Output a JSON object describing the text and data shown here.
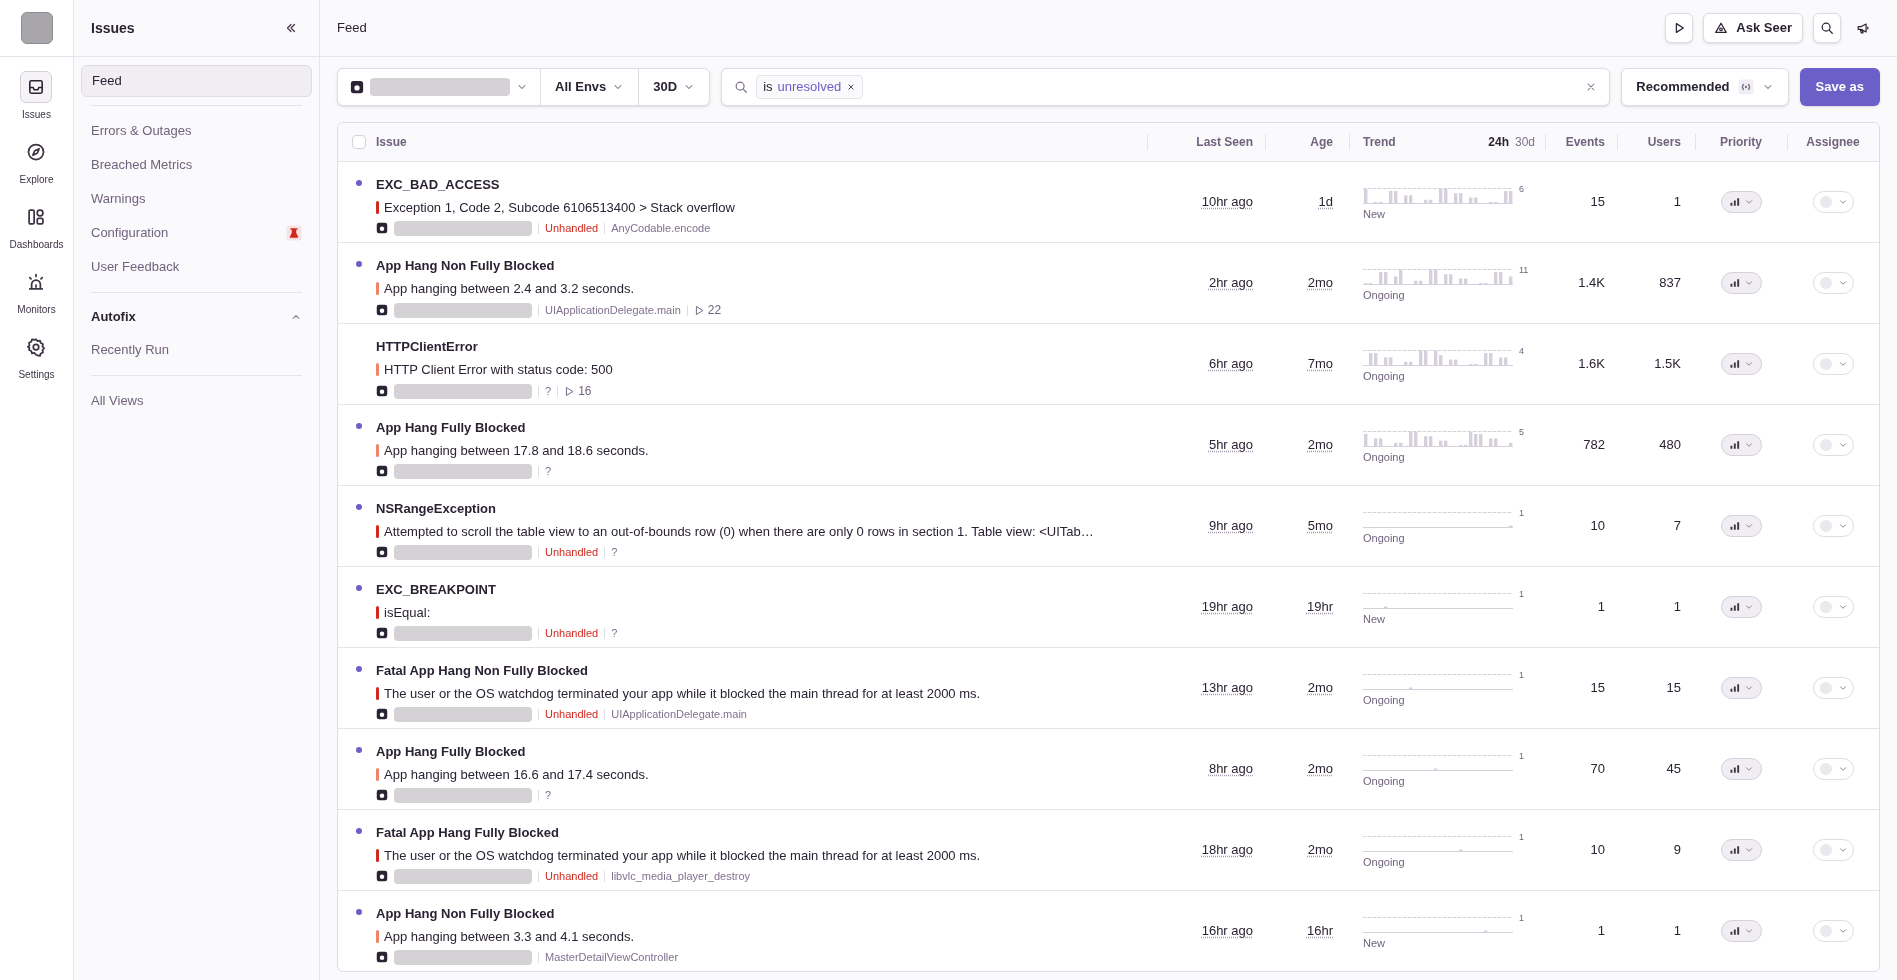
{
  "nav": {
    "items": [
      {
        "kind": "issues",
        "label": "Issues",
        "selected": true
      },
      {
        "kind": "explore",
        "label": "Explore",
        "selected": false
      },
      {
        "kind": "dashboards",
        "label": "Dashboards",
        "selected": false
      },
      {
        "kind": "monitors",
        "label": "Monitors",
        "selected": false
      },
      {
        "kind": "settings",
        "label": "Settings",
        "selected": false
      }
    ]
  },
  "sidebar": {
    "title": "Issues",
    "sections": [
      {
        "items": [
          {
            "label": "Feed",
            "selected": true,
            "badge": false
          }
        ]
      },
      {
        "items": [
          {
            "label": "Errors & Outages",
            "selected": false,
            "badge": false
          },
          {
            "label": "Breached Metrics",
            "selected": false,
            "badge": false
          },
          {
            "label": "Warnings",
            "selected": false,
            "badge": false
          },
          {
            "label": "Configuration",
            "selected": false,
            "badge": true
          },
          {
            "label": "User Feedback",
            "selected": false,
            "badge": false
          }
        ]
      },
      {
        "title": "Autofix",
        "expanded": true,
        "items": [
          {
            "label": "Recently Run",
            "selected": false,
            "badge": false
          }
        ]
      },
      {
        "items": [
          {
            "label": "All Views",
            "selected": false,
            "badge": false
          }
        ]
      }
    ]
  },
  "header": {
    "title": "Feed",
    "buttons": [
      {
        "kind": "play"
      },
      {
        "kind": "seer",
        "label": "Ask Seer"
      },
      {
        "kind": "search"
      },
      {
        "kind": "megaphone"
      }
    ]
  },
  "filters": {
    "environment": "All Envs",
    "period": "30D",
    "search": {
      "token_key": "is",
      "token_value": "unresolved"
    },
    "sort": "Recommended",
    "save": "Save as"
  },
  "table": {
    "select_all_checked": false,
    "columns": [
      "Issue",
      "Last Seen",
      "Age",
      "Trend",
      "Events",
      "Users",
      "Priority",
      "Assignee"
    ],
    "trend_periods": [
      {
        "label": "24h",
        "selected": true
      },
      {
        "label": "30d",
        "selected": false
      }
    ],
    "rows": [
      {
        "unread": true,
        "title": "EXC_BAD_ACCESS",
        "message": "Exception 1, Code 2, Subcode 6106513400 > Stack overflow",
        "color": "#d1291f",
        "tag": "Unhandled",
        "culprit": "AnyCodable.encode",
        "last_seen": "10hr ago",
        "age": "1d",
        "trend_max": "6",
        "trend_status": "New",
        "events": "15",
        "users": "1"
      },
      {
        "unread": true,
        "title": "App Hang Non Fully Blocked",
        "message": "App hanging between 2.4 and 3.2 seconds.",
        "color": "#f2836b",
        "culprit": "UIApplicationDelegate.main",
        "replays": "22",
        "last_seen": "2hr ago",
        "age": "2mo",
        "trend_max": "11",
        "trend_status": "Ongoing",
        "events": "1.4K",
        "users": "837"
      },
      {
        "unread": false,
        "title": "HTTPClientError",
        "message": "HTTP Client Error with status code: 500",
        "color": "#f2836b",
        "culprit": "?",
        "replays": "16",
        "last_seen": "6hr ago",
        "age": "7mo",
        "trend_max": "4",
        "trend_status": "Ongoing",
        "events": "1.6K",
        "users": "1.5K"
      },
      {
        "unread": true,
        "title": "App Hang Fully Blocked",
        "message": "App hanging between 17.8 and 18.6 seconds.",
        "color": "#f2836b",
        "culprit": "?",
        "last_seen": "5hr ago",
        "age": "2mo",
        "trend_max": "5",
        "trend_status": "Ongoing",
        "events": "782",
        "users": "480"
      },
      {
        "unread": true,
        "title": "NSRangeException",
        "message": "Attempted to scroll the table view to an out-of-bounds row (0) when there are only 0 rows in section 1. Table view: <UITab…",
        "color": "#d1291f",
        "tag": "Unhandled",
        "culprit": "?",
        "last_seen": "9hr ago",
        "age": "5mo",
        "trend_max": "1",
        "trend_status": "Ongoing",
        "events": "10",
        "users": "7"
      },
      {
        "unread": true,
        "title": "EXC_BREAKPOINT",
        "message": "isEqual:",
        "color": "#d1291f",
        "tag": "Unhandled",
        "culprit": "?",
        "last_seen": "19hr ago",
        "age": "19hr",
        "trend_max": "1",
        "trend_status": "New",
        "events": "1",
        "users": "1"
      },
      {
        "unread": true,
        "title": "Fatal App Hang Non Fully Blocked",
        "message": "The user or the OS watchdog terminated your app while it blocked the main thread for at least 2000 ms.",
        "color": "#d1291f",
        "tag": "Unhandled",
        "culprit": "UIApplicationDelegate.main",
        "last_seen": "13hr ago",
        "age": "2mo",
        "trend_max": "1",
        "trend_status": "Ongoing",
        "events": "15",
        "users": "15"
      },
      {
        "unread": true,
        "title": "App Hang Fully Blocked",
        "message": "App hanging between 16.6 and 17.4 seconds.",
        "color": "#f2836b",
        "culprit": "?",
        "last_seen": "8hr ago",
        "age": "2mo",
        "trend_max": "1",
        "trend_status": "Ongoing",
        "events": "70",
        "users": "45"
      },
      {
        "unread": true,
        "title": "Fatal App Hang Fully Blocked",
        "message": "The user or the OS watchdog terminated your app while it blocked the main thread for at least 2000 ms.",
        "color": "#d1291f",
        "tag": "Unhandled",
        "culprit": "libvlc_media_player_destroy",
        "last_seen": "18hr ago",
        "age": "2mo",
        "trend_max": "1",
        "trend_status": "Ongoing",
        "events": "10",
        "users": "9"
      },
      {
        "unread": true,
        "title": "App Hang Non Fully Blocked",
        "message": "App hanging between 3.3 and 4.1 seconds.",
        "color": "#f2836b",
        "culprit": "MasterDetailViewController",
        "last_seen": "16hr ago",
        "age": "16hr",
        "trend_max": "1",
        "trend_status": "New",
        "events": "1",
        "users": "1"
      }
    ]
  }
}
